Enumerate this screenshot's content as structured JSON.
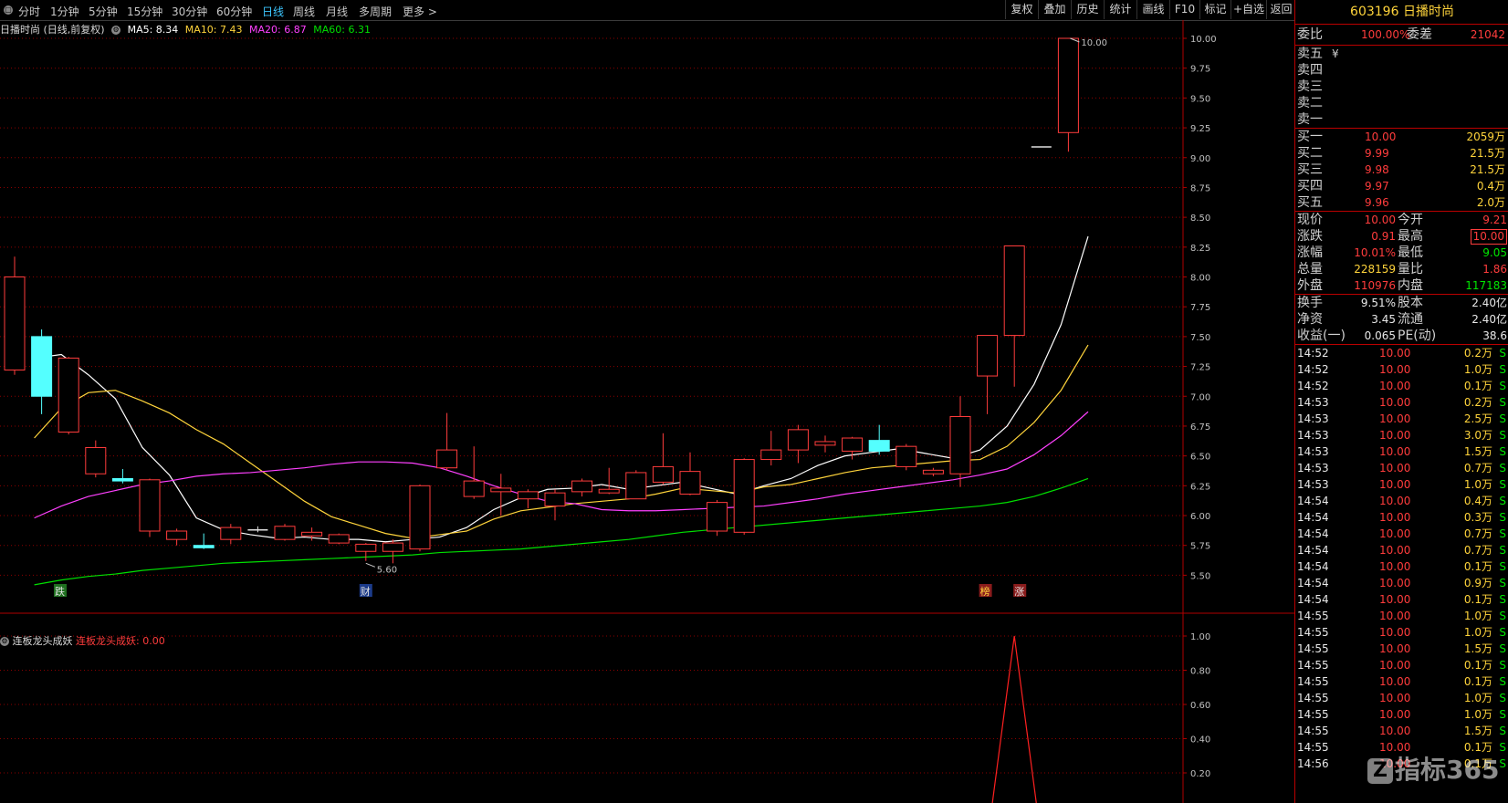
{
  "toolbar": {
    "periods": [
      "分时",
      "1分钟",
      "5分钟",
      "15分钟",
      "30分钟",
      "60分钟",
      "日线",
      "周线",
      "月线",
      "多周期",
      "更多 >"
    ],
    "active_period": "日线",
    "tools": [
      "复权",
      "叠加",
      "历史",
      "统计",
      "画线",
      "F10",
      "标记",
      "+自选",
      "返回"
    ]
  },
  "main_chart": {
    "title": "日播时尚 (日线,前复权)",
    "ma": [
      {
        "label": "MA5: 8.34",
        "color": "#ffffff"
      },
      {
        "label": "MA10: 7.43",
        "color": "#ffd43b"
      },
      {
        "label": "MA20: 6.87",
        "color": "#ff40ff"
      },
      {
        "label": "MA60: 6.31",
        "color": "#00e000"
      }
    ],
    "y_ticks": [
      "10.00",
      "9.75",
      "9.50",
      "9.25",
      "9.00",
      "8.75",
      "8.50",
      "8.25",
      "8.00",
      "7.75",
      "7.50",
      "7.25",
      "7.00",
      "6.75",
      "6.50",
      "6.25",
      "6.00",
      "5.75",
      "5.50"
    ],
    "high_label": "10.00",
    "low_label": "5.60",
    "markers": [
      "跌",
      "财",
      "榜",
      "涨"
    ]
  },
  "chart_data": [
    {
      "type": "candlestick",
      "title": "日播时尚 (日线,前复权)",
      "ylim": [
        5.3,
        10.05
      ],
      "candles": [
        {
          "o": 7.22,
          "c": 8.0,
          "h": 8.17,
          "l": 7.18
        },
        {
          "o": 7.5,
          "c": 7.0,
          "h": 7.56,
          "l": 6.85
        },
        {
          "o": 6.7,
          "c": 7.32,
          "h": 7.33,
          "l": 6.68
        },
        {
          "o": 6.35,
          "c": 6.57,
          "h": 6.63,
          "l": 6.32
        },
        {
          "o": 6.31,
          "c": 6.29,
          "h": 6.39,
          "l": 6.27
        },
        {
          "o": 5.87,
          "c": 6.3,
          "h": 6.31,
          "l": 5.82
        },
        {
          "o": 5.8,
          "c": 5.87,
          "h": 5.89,
          "l": 5.75
        },
        {
          "o": 5.75,
          "c": 5.73,
          "h": 5.85,
          "l": 5.72
        },
        {
          "o": 5.8,
          "c": 5.9,
          "h": 5.93,
          "l": 5.76
        },
        {
          "o": 5.88,
          "c": 5.88,
          "h": 5.91,
          "l": 5.86
        },
        {
          "o": 5.8,
          "c": 5.91,
          "h": 5.93,
          "l": 5.79
        },
        {
          "o": 5.83,
          "c": 5.86,
          "h": 5.9,
          "l": 5.79
        },
        {
          "o": 5.77,
          "c": 5.84,
          "h": 5.85,
          "l": 5.76
        },
        {
          "o": 5.7,
          "c": 5.76,
          "h": 5.77,
          "l": 5.62
        },
        {
          "o": 5.7,
          "c": 5.77,
          "h": 5.8,
          "l": 5.6
        },
        {
          "o": 5.72,
          "c": 6.25,
          "h": 6.26,
          "l": 5.7
        },
        {
          "o": 6.4,
          "c": 6.55,
          "h": 6.86,
          "l": 6.38
        },
        {
          "o": 6.16,
          "c": 6.29,
          "h": 6.58,
          "l": 6.14
        },
        {
          "o": 6.2,
          "c": 6.23,
          "h": 6.35,
          "l": 6.0
        },
        {
          "o": 6.14,
          "c": 6.2,
          "h": 6.22,
          "l": 6.06
        },
        {
          "o": 6.08,
          "c": 6.19,
          "h": 6.22,
          "l": 5.96
        },
        {
          "o": 6.2,
          "c": 6.29,
          "h": 6.31,
          "l": 6.16
        },
        {
          "o": 6.19,
          "c": 6.22,
          "h": 6.4,
          "l": 6.18
        },
        {
          "o": 6.14,
          "c": 6.36,
          "h": 6.38,
          "l": 6.14
        },
        {
          "o": 6.28,
          "c": 6.41,
          "h": 6.69,
          "l": 6.26
        },
        {
          "o": 6.18,
          "c": 6.37,
          "h": 6.53,
          "l": 6.17
        },
        {
          "o": 5.87,
          "c": 6.11,
          "h": 6.13,
          "l": 5.83
        },
        {
          "o": 5.86,
          "c": 6.47,
          "h": 6.48,
          "l": 5.84
        },
        {
          "o": 6.47,
          "c": 6.55,
          "h": 6.71,
          "l": 6.42
        },
        {
          "o": 6.55,
          "c": 6.72,
          "h": 6.76,
          "l": 6.44
        },
        {
          "o": 6.59,
          "c": 6.62,
          "h": 6.67,
          "l": 6.53
        },
        {
          "o": 6.54,
          "c": 6.65,
          "h": 6.66,
          "l": 6.47
        },
        {
          "o": 6.63,
          "c": 6.54,
          "h": 6.76,
          "l": 6.51
        },
        {
          "o": 6.41,
          "c": 6.58,
          "h": 6.6,
          "l": 6.38
        },
        {
          "o": 6.35,
          "c": 6.38,
          "h": 6.4,
          "l": 6.33
        },
        {
          "o": 6.35,
          "c": 6.83,
          "h": 7.0,
          "l": 6.24
        },
        {
          "o": 7.17,
          "c": 7.51,
          "h": 7.51,
          "l": 6.85
        },
        {
          "o": 7.51,
          "c": 8.26,
          "h": 8.26,
          "l": 7.08
        },
        {
          "o": 9.09,
          "c": 9.09,
          "h": 9.09,
          "l": 9.09
        },
        {
          "o": 9.21,
          "c": 10.0,
          "h": 10.0,
          "l": 9.05
        }
      ],
      "ma": {
        "MA5": [
          7.32,
          7.35,
          7.18,
          6.98,
          6.57,
          6.34,
          5.98,
          5.88,
          5.84,
          5.81,
          5.82,
          5.8,
          5.8,
          5.78,
          5.8,
          5.82,
          5.9,
          6.05,
          6.15,
          6.22,
          6.23,
          6.26,
          6.22,
          6.25,
          6.28,
          6.23,
          6.18,
          6.25,
          6.31,
          6.42,
          6.5,
          6.53,
          6.56,
          6.52,
          6.48,
          6.55,
          6.75,
          7.1,
          7.6,
          8.34
        ],
        "MA10": [
          6.65,
          6.9,
          7.03,
          7.05,
          6.96,
          6.86,
          6.72,
          6.6,
          6.44,
          6.28,
          6.12,
          5.99,
          5.92,
          5.85,
          5.81,
          5.84,
          5.87,
          5.97,
          6.04,
          6.07,
          6.1,
          6.12,
          6.14,
          6.18,
          6.23,
          6.21,
          6.19,
          6.24,
          6.26,
          6.31,
          6.36,
          6.4,
          6.42,
          6.44,
          6.46,
          6.47,
          6.58,
          6.78,
          7.05,
          7.43
        ],
        "MA20": [
          5.98,
          6.08,
          6.16,
          6.21,
          6.26,
          6.29,
          6.33,
          6.35,
          6.36,
          6.38,
          6.4,
          6.43,
          6.45,
          6.45,
          6.44,
          6.4,
          6.33,
          6.25,
          6.18,
          6.12,
          6.1,
          6.05,
          6.04,
          6.04,
          6.05,
          6.06,
          6.07,
          6.08,
          6.11,
          6.14,
          6.18,
          6.21,
          6.24,
          6.27,
          6.3,
          6.34,
          6.39,
          6.51,
          6.67,
          6.87
        ],
        "MA60": [
          5.42,
          5.46,
          5.49,
          5.51,
          5.54,
          5.56,
          5.58,
          5.6,
          5.61,
          5.62,
          5.63,
          5.64,
          5.65,
          5.66,
          5.67,
          5.69,
          5.7,
          5.71,
          5.72,
          5.74,
          5.76,
          5.78,
          5.8,
          5.83,
          5.86,
          5.88,
          5.9,
          5.92,
          5.94,
          5.96,
          5.98,
          6.0,
          6.02,
          6.04,
          6.06,
          6.08,
          6.11,
          6.16,
          6.23,
          6.31
        ]
      }
    },
    {
      "type": "line",
      "title": "连板龙头成妖",
      "ylim": [
        0,
        1.1
      ],
      "values": [
        0,
        0,
        0,
        0,
        0,
        0,
        0,
        0,
        0,
        0,
        0,
        0,
        0,
        0,
        0,
        0,
        0,
        0,
        0,
        0,
        0,
        0,
        0,
        0,
        0,
        0,
        0,
        0,
        0,
        0,
        0,
        0,
        0,
        0,
        0,
        0,
        0,
        1,
        0,
        0
      ]
    }
  ],
  "lower_chart": {
    "name": "连板龙头成妖",
    "value_label": "连板龙头成妖: 0.00",
    "y_ticks": [
      "1.00",
      "0.80",
      "0.60",
      "0.40",
      "0.20"
    ]
  },
  "quote": {
    "code": "603196",
    "name": "日播时尚",
    "weibi_label": "委比",
    "weibi": "100.00%",
    "weicha_label": "委差",
    "weicha": "21042",
    "sell": [
      {
        "label": "卖五",
        "price": "¥",
        "vol": ""
      },
      {
        "label": "卖四",
        "price": "",
        "vol": ""
      },
      {
        "label": "卖三",
        "price": "",
        "vol": ""
      },
      {
        "label": "卖二",
        "price": "",
        "vol": ""
      },
      {
        "label": "卖一",
        "price": "",
        "vol": ""
      }
    ],
    "buy": [
      {
        "label": "买一",
        "price": "10.00",
        "vol": "2059万"
      },
      {
        "label": "买二",
        "price": "9.99",
        "vol": "21.5万"
      },
      {
        "label": "买三",
        "price": "9.98",
        "vol": "21.5万"
      },
      {
        "label": "买四",
        "price": "9.97",
        "vol": "0.4万"
      },
      {
        "label": "买五",
        "price": "9.96",
        "vol": "2.0万"
      }
    ],
    "stats": [
      {
        "l1": "现价",
        "v1": "10.00",
        "c1": "red",
        "l2": "今开",
        "v2": "9.21",
        "c2": "red",
        "box": false
      },
      {
        "l1": "涨跌",
        "v1": "0.91",
        "c1": "red",
        "l2": "最高",
        "v2": "10.00",
        "c2": "red",
        "box": true
      },
      {
        "l1": "涨幅",
        "v1": "10.01%",
        "c1": "red",
        "l2": "最低",
        "v2": "9.05",
        "c2": "green",
        "box": false
      },
      {
        "l1": "总量",
        "v1": "228159",
        "c1": "yellow",
        "l2": "量比",
        "v2": "1.86",
        "c2": "red",
        "box": false
      },
      {
        "l1": "外盘",
        "v1": "110976",
        "c1": "red",
        "l2": "内盘",
        "v2": "117183",
        "c2": "green",
        "box": false
      }
    ],
    "stats2": [
      {
        "l1": "换手",
        "v1": "9.51%",
        "l2": "股本",
        "v2": "2.40亿"
      },
      {
        "l1": "净资",
        "v1": "3.45",
        "l2": "流通",
        "v2": "2.40亿"
      },
      {
        "l1": "收益(一)",
        "v1": "0.065",
        "l2": "PE(动)",
        "v2": "38.6"
      }
    ]
  },
  "ticks": [
    {
      "time": "14:52",
      "price": "10.00",
      "vol": "0.2万",
      "side": "S"
    },
    {
      "time": "14:52",
      "price": "10.00",
      "vol": "1.0万",
      "side": "S"
    },
    {
      "time": "14:52",
      "price": "10.00",
      "vol": "0.1万",
      "side": "S"
    },
    {
      "time": "14:53",
      "price": "10.00",
      "vol": "0.2万",
      "side": "S"
    },
    {
      "time": "14:53",
      "price": "10.00",
      "vol": "2.5万",
      "side": "S"
    },
    {
      "time": "14:53",
      "price": "10.00",
      "vol": "3.0万",
      "side": "S"
    },
    {
      "time": "14:53",
      "price": "10.00",
      "vol": "1.5万",
      "side": "S"
    },
    {
      "time": "14:53",
      "price": "10.00",
      "vol": "0.7万",
      "side": "S"
    },
    {
      "time": "14:53",
      "price": "10.00",
      "vol": "1.0万",
      "side": "S"
    },
    {
      "time": "14:54",
      "price": "10.00",
      "vol": "0.4万",
      "side": "S"
    },
    {
      "time": "14:54",
      "price": "10.00",
      "vol": "0.3万",
      "side": "S"
    },
    {
      "time": "14:54",
      "price": "10.00",
      "vol": "0.7万",
      "side": "S"
    },
    {
      "time": "14:54",
      "price": "10.00",
      "vol": "0.7万",
      "side": "S"
    },
    {
      "time": "14:54",
      "price": "10.00",
      "vol": "0.1万",
      "side": "S"
    },
    {
      "time": "14:54",
      "price": "10.00",
      "vol": "0.9万",
      "side": "S"
    },
    {
      "time": "14:54",
      "price": "10.00",
      "vol": "0.1万",
      "side": "S"
    },
    {
      "time": "14:55",
      "price": "10.00",
      "vol": "1.0万",
      "side": "S"
    },
    {
      "time": "14:55",
      "price": "10.00",
      "vol": "1.0万",
      "side": "S"
    },
    {
      "time": "14:55",
      "price": "10.00",
      "vol": "1.5万",
      "side": "S"
    },
    {
      "time": "14:55",
      "price": "10.00",
      "vol": "0.1万",
      "side": "S"
    },
    {
      "time": "14:55",
      "price": "10.00",
      "vol": "0.1万",
      "side": "S"
    },
    {
      "time": "14:55",
      "price": "10.00",
      "vol": "1.0万",
      "side": "S"
    },
    {
      "time": "14:55",
      "price": "10.00",
      "vol": "1.0万",
      "side": "S"
    },
    {
      "time": "14:55",
      "price": "10.00",
      "vol": "1.5万",
      "side": "S"
    },
    {
      "time": "14:55",
      "price": "10.00",
      "vol": "0.1万",
      "side": "S"
    },
    {
      "time": "14:56",
      "price": "10.00",
      "vol": "0.1万",
      "side": "S"
    }
  ],
  "watermark": {
    "logo": "Z",
    "text": "指标365"
  },
  "colors": {
    "up": "#ff3c3c",
    "down": "#54ffff",
    "grid": "#8b0000",
    "border": "#b00000"
  }
}
